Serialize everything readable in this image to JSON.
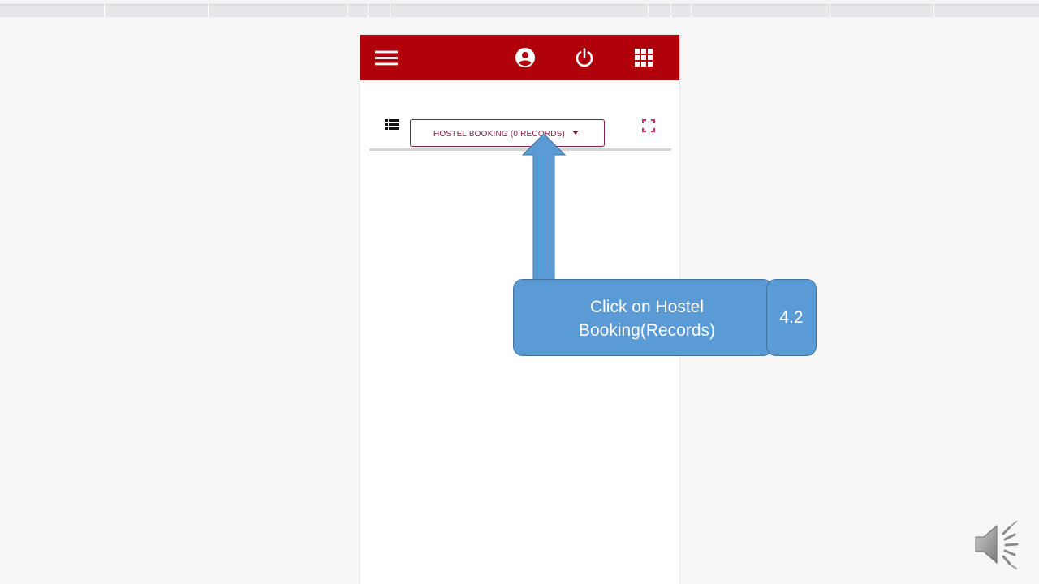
{
  "dropdown": {
    "label": "HOSTEL BOOKING (0 RECORDS)"
  },
  "callout": {
    "line1": "Click on Hostel",
    "line2": "Booking(Records)",
    "step": "4.2"
  },
  "icons": {
    "menu": "hamburger-menu-icon",
    "account": "account-circle-icon",
    "power": "power-icon",
    "apps": "apps-grid-icon",
    "list": "list-view-icon",
    "fullscreen": "fullscreen-icon",
    "speaker": "speaker-icon"
  },
  "colors": {
    "appbar": "#b0000c",
    "select_border": "#8a1d45",
    "callout_fill": "#5b9bd5",
    "callout_border": "#41719c"
  }
}
